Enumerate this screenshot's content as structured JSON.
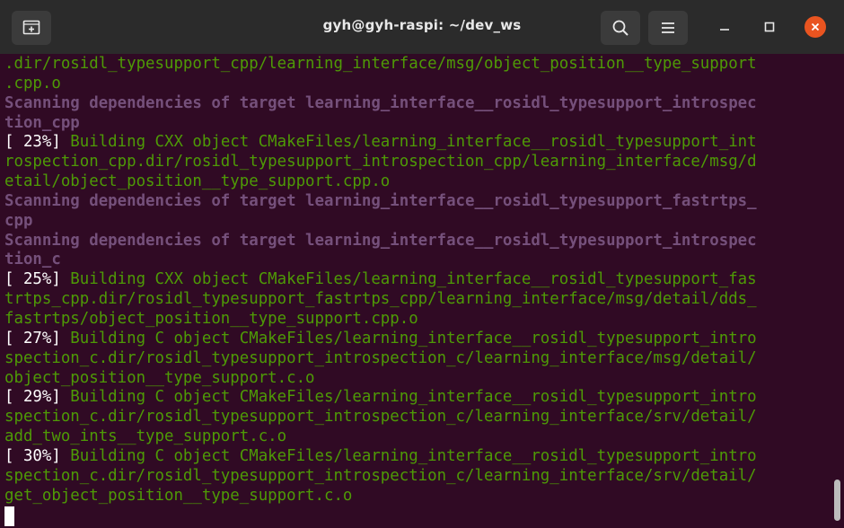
{
  "window": {
    "title": "gyh@gyh-raspi: ~/dev_ws"
  },
  "icons": {
    "new_tab": "new-tab-icon",
    "search": "search-icon",
    "menu": "hamburger-menu-icon",
    "minimize": "minimize-icon",
    "maximize": "maximize-icon",
    "close": "close-icon"
  },
  "colors": {
    "terminal_bg": "#300a24",
    "titlebar_bg": "#2b2b2b",
    "output_green": "#4e9a06",
    "scanning_magenta": "#75507b",
    "progress_white": "#ffffff",
    "close_orange": "#e95420"
  },
  "terminal": {
    "lines": [
      {
        "prefix": "",
        "text": ".dir/rosidl_typesupport_cpp/learning_interface/msg/object_position__type_support",
        "style": "green"
      },
      {
        "prefix": "",
        "text": ".cpp.o",
        "style": "green"
      },
      {
        "prefix": "",
        "text": "Scanning dependencies of target learning_interface__rosidl_typesupport_introspec",
        "style": "magenta"
      },
      {
        "prefix": "",
        "text": "tion_cpp",
        "style": "magenta"
      },
      {
        "prefix": "[ 23%] ",
        "text": "Building CXX object CMakeFiles/learning_interface__rosidl_typesupport_int",
        "style": "green"
      },
      {
        "prefix": "",
        "text": "rospection_cpp.dir/rosidl_typesupport_introspection_cpp/learning_interface/msg/d",
        "style": "green"
      },
      {
        "prefix": "",
        "text": "etail/object_position__type_support.cpp.o",
        "style": "green"
      },
      {
        "prefix": "",
        "text": "Scanning dependencies of target learning_interface__rosidl_typesupport_fastrtps_",
        "style": "magenta"
      },
      {
        "prefix": "",
        "text": "cpp",
        "style": "magenta"
      },
      {
        "prefix": "",
        "text": "Scanning dependencies of target learning_interface__rosidl_typesupport_introspec",
        "style": "magenta"
      },
      {
        "prefix": "",
        "text": "tion_c",
        "style": "magenta"
      },
      {
        "prefix": "[ 25%] ",
        "text": "Building CXX object CMakeFiles/learning_interface__rosidl_typesupport_fas",
        "style": "green"
      },
      {
        "prefix": "",
        "text": "trtps_cpp.dir/rosidl_typesupport_fastrtps_cpp/learning_interface/msg/detail/dds_",
        "style": "green"
      },
      {
        "prefix": "",
        "text": "fastrtps/object_position__type_support.cpp.o",
        "style": "green"
      },
      {
        "prefix": "[ 27%] ",
        "text": "Building C object CMakeFiles/learning_interface__rosidl_typesupport_intro",
        "style": "green"
      },
      {
        "prefix": "",
        "text": "spection_c.dir/rosidl_typesupport_introspection_c/learning_interface/msg/detail/",
        "style": "green"
      },
      {
        "prefix": "",
        "text": "object_position__type_support.c.o",
        "style": "green"
      },
      {
        "prefix": "[ 29%] ",
        "text": "Building C object CMakeFiles/learning_interface__rosidl_typesupport_intro",
        "style": "green"
      },
      {
        "prefix": "",
        "text": "spection_c.dir/rosidl_typesupport_introspection_c/learning_interface/srv/detail/",
        "style": "green"
      },
      {
        "prefix": "",
        "text": "add_two_ints__type_support.c.o",
        "style": "green"
      },
      {
        "prefix": "[ 30%] ",
        "text": "Building C object CMakeFiles/learning_interface__rosidl_typesupport_intro",
        "style": "green"
      },
      {
        "prefix": "",
        "text": "spection_c.dir/rosidl_typesupport_introspection_c/learning_interface/srv/detail/",
        "style": "green"
      },
      {
        "prefix": "",
        "text": "get_object_position__type_support.c.o",
        "style": "green"
      }
    ]
  }
}
